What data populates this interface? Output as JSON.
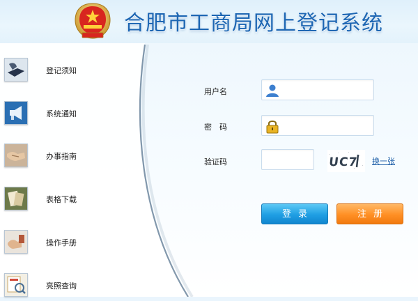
{
  "header": {
    "title": "合肥市工商局网上登记系统"
  },
  "sidebar": {
    "items": [
      {
        "label": "登记须知",
        "icon": "notice-icon"
      },
      {
        "label": "系统通知",
        "icon": "megaphone-icon"
      },
      {
        "label": "办事指南",
        "icon": "handshake-icon"
      },
      {
        "label": "表格下载",
        "icon": "download-form-icon"
      },
      {
        "label": "操作手册",
        "icon": "manual-icon"
      },
      {
        "label": "亮照查询",
        "icon": "license-search-icon"
      }
    ]
  },
  "form": {
    "username_label": "用户名",
    "username_value": "",
    "password_label": "密　码",
    "password_value": "",
    "captcha_label": "验证码",
    "captcha_value": "",
    "captcha_text": "UC7",
    "refresh_label": "换一张",
    "login_label": "登录",
    "register_label": "注册"
  },
  "colors": {
    "title": "#1d66b3",
    "login_button": "#1f9ee3",
    "register_button": "#ff8f24",
    "link": "#1e5fa8"
  }
}
